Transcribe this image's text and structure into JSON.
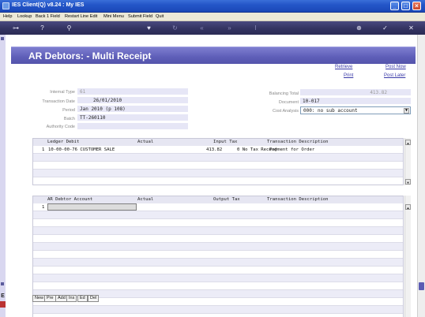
{
  "window": {
    "title": "IES Client(Q) v8.24 : My IES",
    "buttons": [
      "_",
      "□",
      "×"
    ]
  },
  "menu": [
    "Help",
    "Lookup",
    "Back 1 Field",
    "Restart Line Edit",
    "Mini Menu",
    "Submit Field",
    "Quit"
  ],
  "toolbar_icons": [
    "key-icon",
    "help-icon",
    "search-icon",
    "heart-icon",
    "refresh-icon",
    "rewind-icon",
    "fast-forward-icon",
    "text-cursor-icon",
    "plus-icon",
    "check-icon",
    "close-icon"
  ],
  "header": {
    "title": "AR Debtors: - Multi Receipt"
  },
  "links": {
    "retrieve": "Retrieve",
    "post_now": "Post Now",
    "print": "Print",
    "post_later": "Post Later"
  },
  "form": {
    "internal_type_label": "Internal Type",
    "internal_type": "61",
    "transaction_date_label": "Transaction Date",
    "transaction_date": "26/01/2010",
    "period_label": "Period",
    "period": "Jan 2010 (p 108)",
    "batch_label": "Batch",
    "batch": "TT-260110",
    "authority_code_label": "Authority Code",
    "authority_code": "",
    "balancing_total_label": "Balancing Total",
    "balancing_total": "413.82",
    "document_label": "Document",
    "document": "10-017",
    "cost_analysis_label": "Cost Analysis",
    "cost_analysis": "000: no sub account"
  },
  "ledger_grid": {
    "headers": [
      "Ledger Debit",
      "Actual",
      "Input Tax",
      "Transaction Description"
    ],
    "rows": [
      {
        "num": "1",
        "ledger": "10-00-00-76 CUSTOMER SALE",
        "actual": "413.82",
        "tax": "0 No Tax Record",
        "desc": "Payment for Order"
      }
    ]
  },
  "ar_grid": {
    "headers": [
      "AR Debtor Account",
      "Actual",
      "Output Tax",
      "Transaction Description"
    ],
    "rows": [
      {
        "num": "1"
      }
    ]
  },
  "bottom_buttons": [
    "New",
    "Pre",
    "Add",
    "Ins",
    "Ed",
    "Del"
  ]
}
